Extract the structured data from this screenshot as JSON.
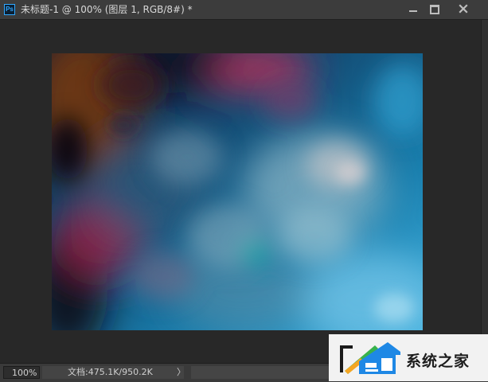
{
  "window": {
    "app_icon_text": "Ps",
    "title": "未标题-1 @ 100% (图层 1, RGB/8#) *"
  },
  "icons": {
    "app": "photoshop-icon",
    "minimize": "minimize-icon",
    "maximize": "maximize-icon",
    "close": "close-icon",
    "status_menu": "chevron-right-icon"
  },
  "statusbar": {
    "zoom": "100%",
    "doc_info": "文档:475.1K/950.2K",
    "menu_arrow": "〉"
  },
  "canvas": {
    "content": "rendered clouds filter image"
  },
  "watermark": {
    "text": "系统之家"
  },
  "colors": {
    "titlebar": "#3c3c3c",
    "canvas_bg": "#282828",
    "statusbar": "#3a3a3a",
    "ps_accent": "#31a8ff"
  }
}
